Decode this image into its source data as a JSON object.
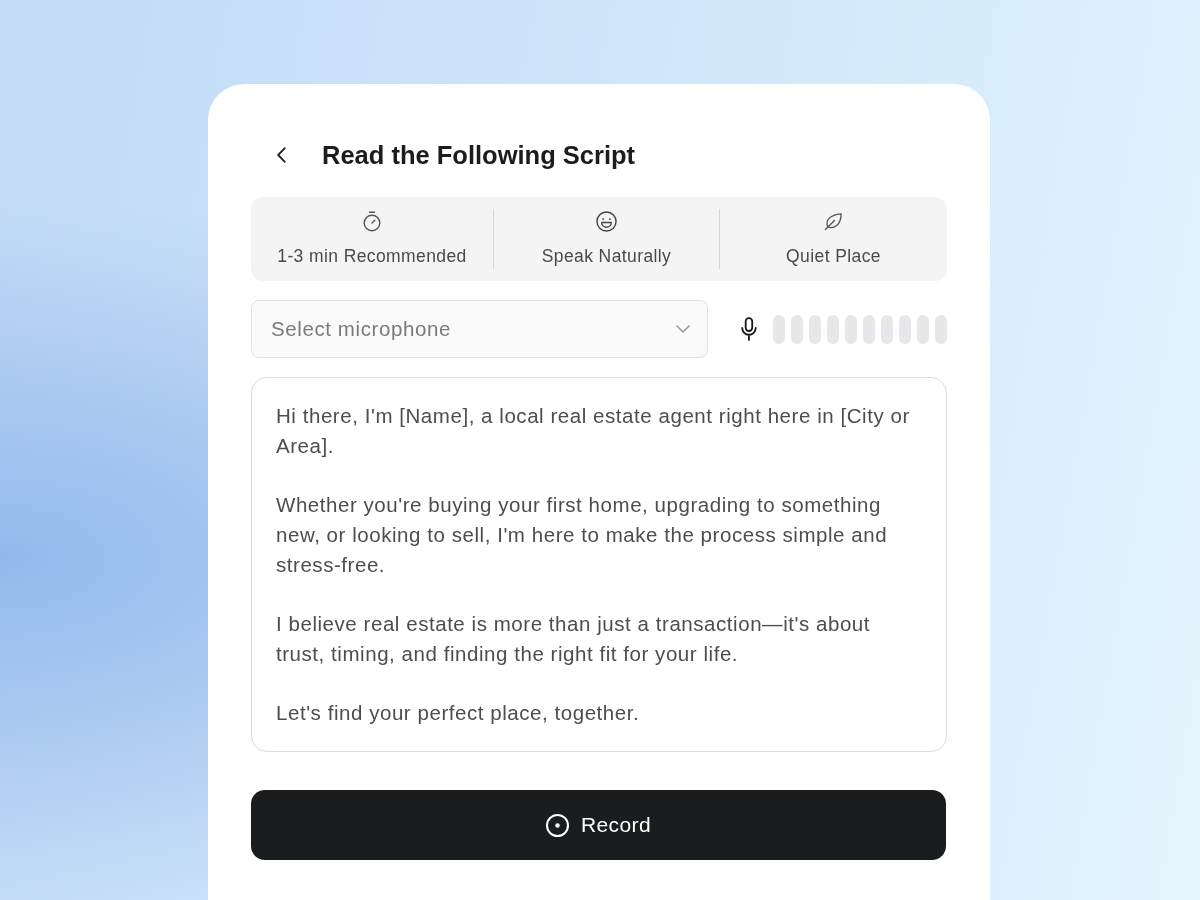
{
  "header": {
    "title": "Read the Following Script"
  },
  "tips": [
    {
      "kind": "timer",
      "label": "1-3 min Recommended"
    },
    {
      "kind": "smile",
      "label": "Speak Naturally"
    },
    {
      "kind": "leaf",
      "label": "Quiet Place"
    }
  ],
  "microphone": {
    "placeholder": "Select microphone"
  },
  "script": {
    "paragraphs": [
      "Hi there, I'm [Name], a local real estate agent right here in [City or Area].",
      "Whether you're buying your first home, upgrading to something new, or looking to sell, I'm here to make the process simple and stress-free.",
      "I believe real estate is more than just a transaction—it's about trust, timing, and finding the right fit for your life.",
      "Let's find your perfect place, together."
    ]
  },
  "record_button": {
    "label": "Record"
  }
}
